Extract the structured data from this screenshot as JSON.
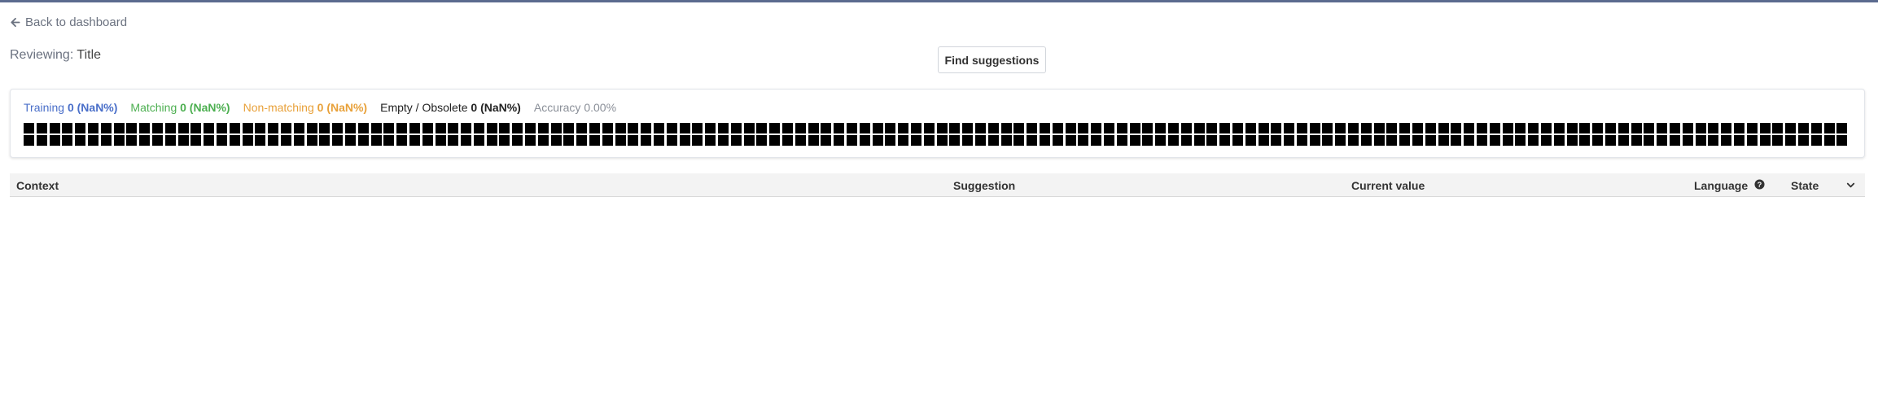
{
  "header": {
    "back_label": "Back to dashboard",
    "reviewing_prefix": "Reviewing:",
    "reviewing_value": "Title",
    "find_button_label": "Find suggestions"
  },
  "stats": {
    "training": {
      "label": "Training",
      "value": "0 (NaN%)"
    },
    "matching": {
      "label": "Matching",
      "value": "0 (NaN%)"
    },
    "nonmatching": {
      "label": "Non-matching",
      "value": "0 (NaN%)"
    },
    "empty": {
      "label": "Empty / Obsolete",
      "value": "0 (NaN%)"
    },
    "accuracy": {
      "label": "Accuracy",
      "value": "0.00%"
    }
  },
  "progress_grid": {
    "cell_count": 284,
    "cell_color": "#000000"
  },
  "table": {
    "columns": {
      "context": "Context",
      "suggestion": "Suggestion",
      "current": "Current value",
      "language": "Language",
      "state": "State"
    }
  },
  "colors": {
    "training": "#4a6fc9",
    "matching": "#4caf50",
    "nonmatching": "#e8a13a",
    "topbar": "#5b6b8f"
  },
  "icons": [
    "arrow-left-icon",
    "help-circle-icon",
    "chevron-down-icon"
  ]
}
